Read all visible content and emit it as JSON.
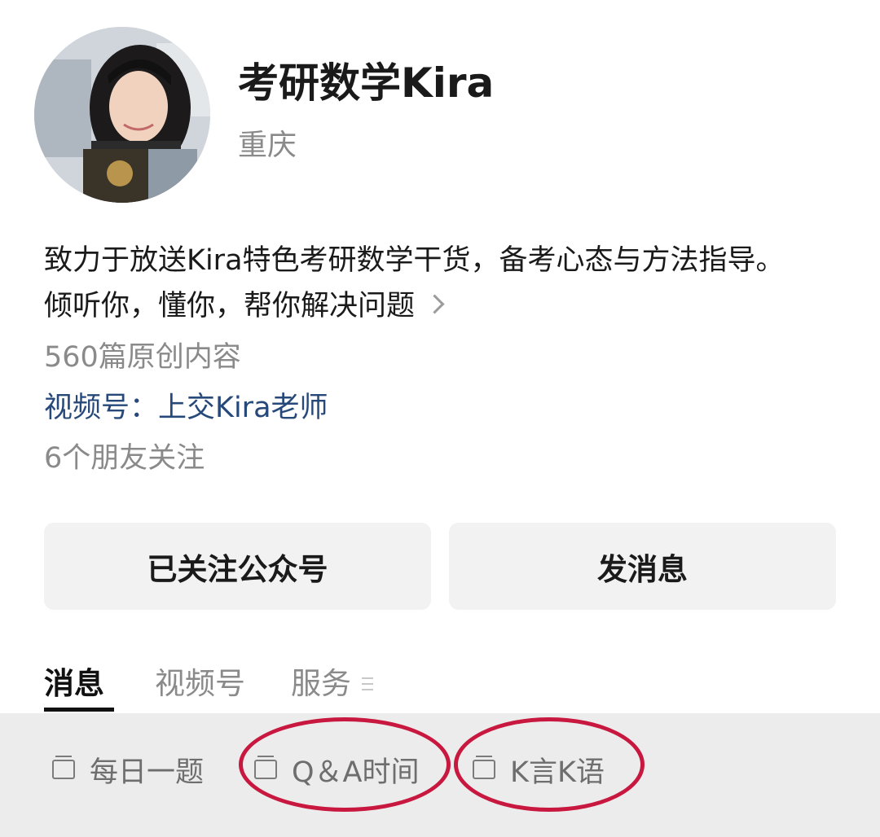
{
  "profile": {
    "name": "考研数学Kira",
    "location": "重庆",
    "bio_line1": "致力于放送Kira特色考研数学干货，备考心态与方法指导。",
    "bio_line2": "倾听你，懂你，帮你解决问题",
    "articles": "560篇原创内容",
    "channel": "视频号：上交Kira老师",
    "friends": "6个朋友关注"
  },
  "actions": {
    "follow_label": "已关注公众号",
    "message_label": "发消息"
  },
  "tabs": [
    {
      "label": "消息",
      "active": true
    },
    {
      "label": "视频号",
      "active": false
    },
    {
      "label": "服务",
      "active": false
    }
  ],
  "bottom_menu": [
    {
      "label": "每日一题",
      "icon": "doc-icon"
    },
    {
      "label": "Q＆A时间",
      "icon": "doc-icon",
      "highlighted": true
    },
    {
      "label": "K言K语",
      "icon": "doc-icon",
      "highlighted": true
    }
  ],
  "colors": {
    "accent_link": "#27497a",
    "highlight": "#c8183f",
    "button_bg": "#f2f2f2",
    "bar_bg": "#ececec"
  }
}
